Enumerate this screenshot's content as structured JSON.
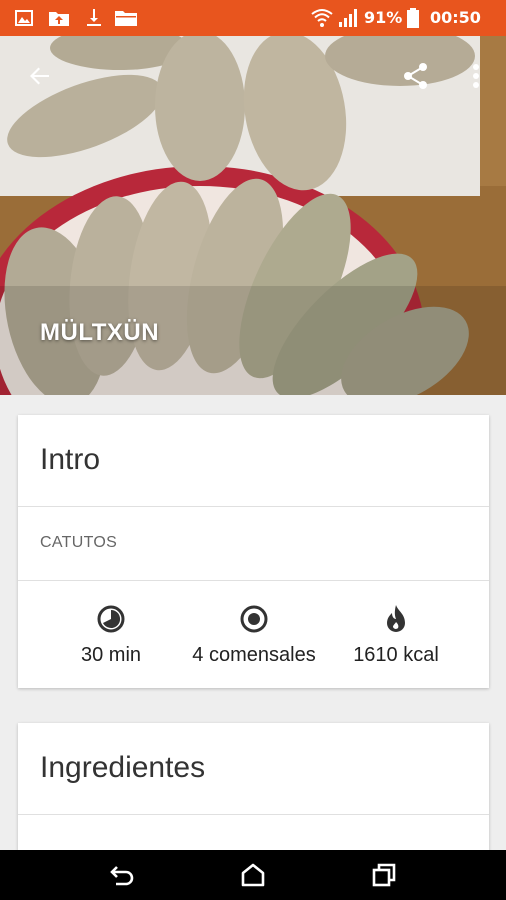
{
  "status_bar": {
    "battery": "91%",
    "time": "00:50",
    "icons": [
      "image-icon",
      "folder-upload-icon",
      "download-icon",
      "folder-icon",
      "wifi-icon",
      "signal-icon",
      "battery-icon"
    ]
  },
  "toolbar": {
    "back_icon": "arrow-back-icon",
    "share_icon": "share-icon",
    "more_icon": "more-vert-icon"
  },
  "recipe": {
    "title": "MÜLTXÜN"
  },
  "intro_card": {
    "title": "Intro",
    "subtitle": "CATUTOS",
    "stats": [
      {
        "icon": "timer-icon",
        "label": "30 min"
      },
      {
        "icon": "radio-target-icon",
        "label": "4 comensales"
      },
      {
        "icon": "flame-icon",
        "label": "1610 kcal"
      }
    ]
  },
  "ingredients_card": {
    "title": "Ingredientes"
  },
  "nav_bar": {
    "icons": [
      "back-nav-icon",
      "home-nav-icon",
      "recents-nav-icon"
    ]
  },
  "colors": {
    "status_bar": "#e8551e",
    "background": "#eeeeee",
    "card": "#ffffff",
    "nav_bar": "#000000"
  }
}
